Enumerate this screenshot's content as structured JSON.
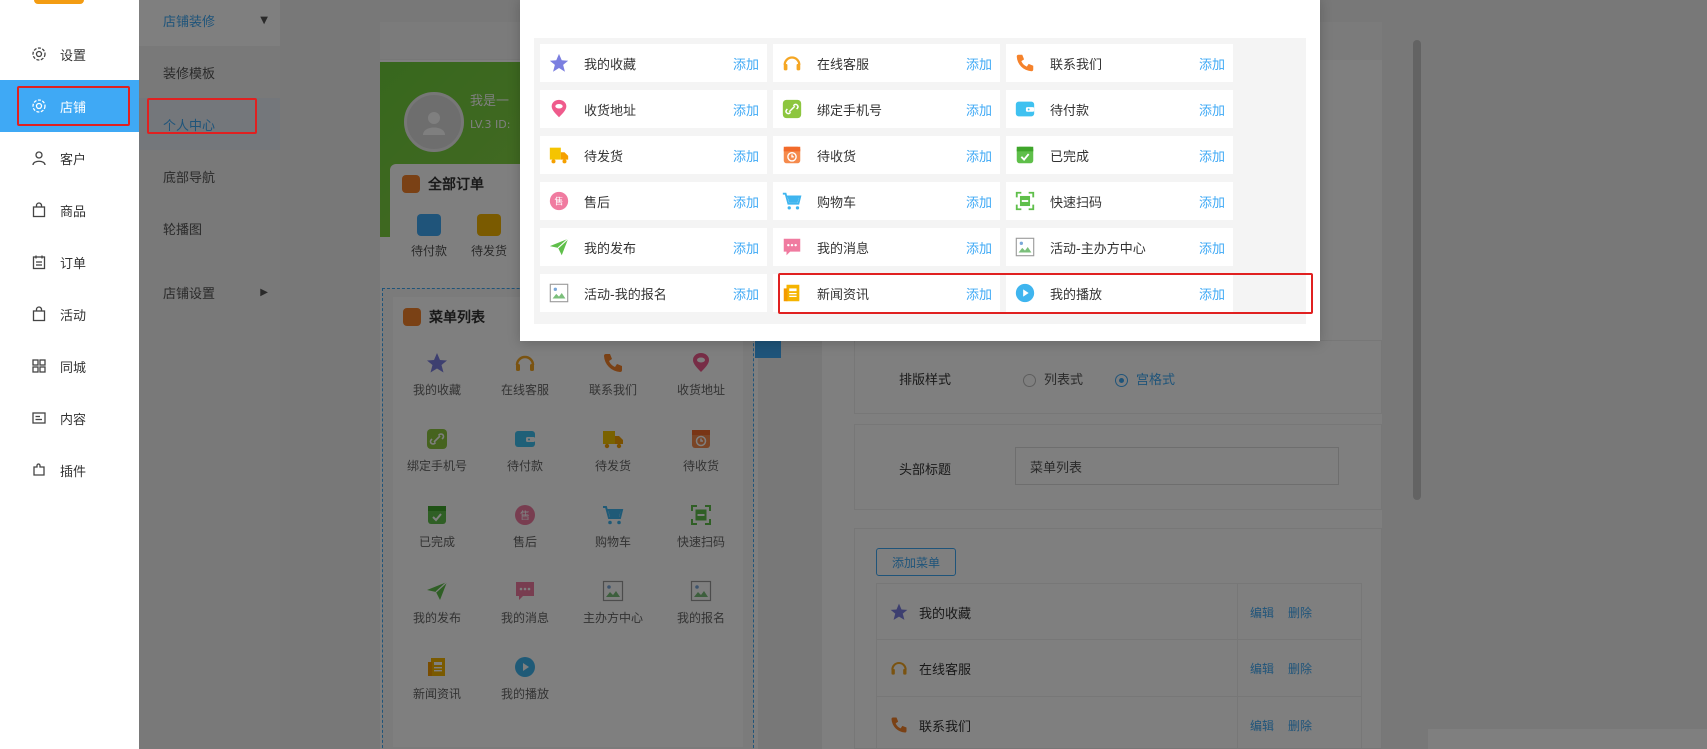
{
  "sidebar": {
    "items": [
      {
        "label": "设置",
        "icon": "gear-icon"
      },
      {
        "label": "店铺",
        "icon": "gear-icon"
      },
      {
        "label": "客户",
        "icon": "user-icon"
      },
      {
        "label": "商品",
        "icon": "bag-icon"
      },
      {
        "label": "订单",
        "icon": "calendar-icon"
      },
      {
        "label": "活动",
        "icon": "bag-icon"
      },
      {
        "label": "同城",
        "icon": "grid-icon"
      },
      {
        "label": "内容",
        "icon": "document-icon"
      },
      {
        "label": "插件",
        "icon": "puzzle-icon"
      }
    ]
  },
  "subsidebar": {
    "group1": "店铺装修",
    "items": [
      "装修模板",
      "个人中心",
      "底部导航",
      "轮播图"
    ],
    "group2": "店铺设置"
  },
  "preview": {
    "user_name": "我是一",
    "user_level": "LV.3   ID:",
    "orders_title": "全部订单",
    "order_items": [
      "待付款",
      "待发货"
    ],
    "menu_title": "菜单列表",
    "grid": [
      "我的收藏",
      "在线客服",
      "联系我们",
      "收货地址",
      "绑定手机号",
      "待付款",
      "待发货",
      "待收货",
      "已完成",
      "售后",
      "购物车",
      "快速扫码",
      "我的发布",
      "我的消息",
      "主办方中心",
      "我的报名",
      "新闻资讯",
      "我的播放"
    ]
  },
  "settings": {
    "layout_label": "排版样式",
    "layout_option_list": "列表式",
    "layout_option_grid": "宫格式",
    "header_title_label": "头部标题",
    "header_title_value": "菜单列表",
    "add_menu_label": "添加菜单",
    "edit_label": "编辑",
    "delete_label": "删除",
    "menu_rows": [
      "我的收藏",
      "在线客服",
      "联系我们"
    ]
  },
  "modal": {
    "add_label": "添加",
    "cells": [
      {
        "label": "我的收藏",
        "icon": "star-icon"
      },
      {
        "label": "在线客服",
        "icon": "headset-icon"
      },
      {
        "label": "联系我们",
        "icon": "phone-icon"
      },
      {
        "label": "收货地址",
        "icon": "location-pin-icon"
      },
      {
        "label": "绑定手机号",
        "icon": "link-icon"
      },
      {
        "label": "待付款",
        "icon": "wallet-icon"
      },
      {
        "label": "待发货",
        "icon": "truck-icon"
      },
      {
        "label": "待收货",
        "icon": "clock-box-icon"
      },
      {
        "label": "已完成",
        "icon": "check-box-icon"
      },
      {
        "label": "售后",
        "icon": "after-sale-icon"
      },
      {
        "label": "购物车",
        "icon": "cart-icon"
      },
      {
        "label": "快速扫码",
        "icon": "scan-icon"
      },
      {
        "label": "我的发布",
        "icon": "paper-plane-icon"
      },
      {
        "label": "我的消息",
        "icon": "message-icon"
      },
      {
        "label": "活动-主办方中心",
        "icon": "broken-image-icon"
      },
      {
        "label": "活动-我的报名",
        "icon": "broken-image-icon"
      },
      {
        "label": "新闻资讯",
        "icon": "newspaper-icon"
      },
      {
        "label": "我的播放",
        "icon": "play-icon"
      }
    ]
  },
  "colors": {
    "accent": "#3fa9f5",
    "highlight": "#e02020"
  }
}
